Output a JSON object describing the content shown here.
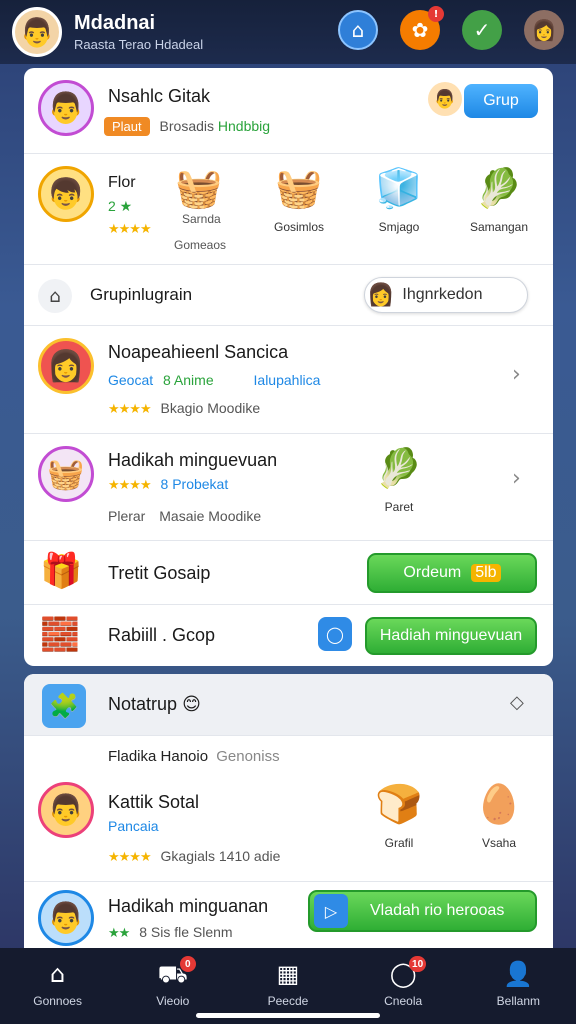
{
  "header": {
    "avatar_icon": "👨",
    "name": "Mdadnai",
    "subtitle": "Raasta Terao Hdadeal",
    "icons": [
      {
        "name": "home-icon",
        "glyph": "⌂",
        "bg": "#2f7fd8",
        "badge": ""
      },
      {
        "name": "gift-icon",
        "glyph": "✿",
        "bg": "#f57c00",
        "badge": "!"
      },
      {
        "name": "check-icon",
        "glyph": "✓",
        "bg": "#43a047",
        "badge": ""
      },
      {
        "name": "friend-avatar-icon",
        "glyph": "👩",
        "bg": "#8d6e63",
        "badge": ""
      }
    ]
  },
  "card1": {
    "profile": {
      "avatar_icon": "👨",
      "name": "Nsahlc Gitak",
      "tag": "Plaut",
      "tag_text": "Brosadis",
      "tag_link": "Hndbbig",
      "button": "Grup"
    },
    "collection": {
      "avatar_icon": "👦",
      "name": "Flor",
      "meta": "2 ★",
      "stars": "★★★★",
      "stars_label": "Sarnda",
      "sub_label": "Gomeaos",
      "items": [
        {
          "icon": "🧺",
          "label": ""
        },
        {
          "icon": "🧺",
          "label": "Gosimlos"
        },
        {
          "icon": "🧊",
          "label": "Smjago"
        },
        {
          "icon": "🥬",
          "label": "Samangan"
        }
      ]
    },
    "group": {
      "icon": "⌂",
      "label": "Grupinlugrain",
      "button_icon": "👩",
      "button_label": "Ihgnrkedon"
    },
    "friend1": {
      "avatar_icon": "👩",
      "name": "Noapeahieenl Sancica",
      "line2a": "Geocat",
      "line2b": "8 Anime",
      "line2c": "Ialupahlica",
      "stars": "★★★★",
      "line3": "Bkagio Moodike",
      "chevron": "›"
    },
    "friend2": {
      "avatar_icon": "🧺",
      "name": "Hadikah minguevuan",
      "stars": "★★★★",
      "line2": "8 Probekat",
      "line3a": "Plerar",
      "line3b": "Masaie Moodike",
      "item_icon": "🥬",
      "item_label": "Paret",
      "chevron": "›"
    },
    "gift": {
      "icon": "🎁",
      "label": "Tretit Gosaip",
      "button": "Ordeum",
      "button_value": "5lb"
    },
    "reward": {
      "icon": "🧱",
      "label": "Rabiill . Gcop",
      "side_icon": "◯",
      "button": "Hadiah minguevuan"
    }
  },
  "card2": {
    "header": {
      "icon": "🧩",
      "label": "Notatrup",
      "emoji": "😊",
      "right_icon": "◇"
    },
    "subheader": {
      "text": "Fladika Hanoio",
      "muted": "Genoniss"
    },
    "friend3": {
      "avatar_icon": "👨",
      "name": "Kattik Sotal",
      "line2": "Pancaia",
      "stars": "★★★★",
      "line3": "Gkagials 1410 adie",
      "items": [
        {
          "icon": "🍞",
          "label": "Grafil"
        },
        {
          "icon": "🥚",
          "label": "Vsaha"
        }
      ]
    },
    "friend4": {
      "avatar_icon": "👨",
      "name": "Hadikah minguanan",
      "stars": "★★",
      "line2": "8 Sis fle Slenm",
      "button_icon": "▷",
      "button": "Vladah rio herooas"
    }
  },
  "bottom_nav": [
    {
      "name": "home",
      "icon": "⌂",
      "label": "Gonnoes",
      "badge": ""
    },
    {
      "name": "shop",
      "icon": "⛟",
      "label": "Vieoio",
      "badge": "0"
    },
    {
      "name": "grid",
      "icon": "▦",
      "label": "Peecde",
      "badge": ""
    },
    {
      "name": "chat",
      "icon": "◯",
      "label": "Cneola",
      "badge": "10"
    },
    {
      "name": "profile",
      "icon": "👤",
      "label": "Bellanm",
      "badge": ""
    }
  ]
}
